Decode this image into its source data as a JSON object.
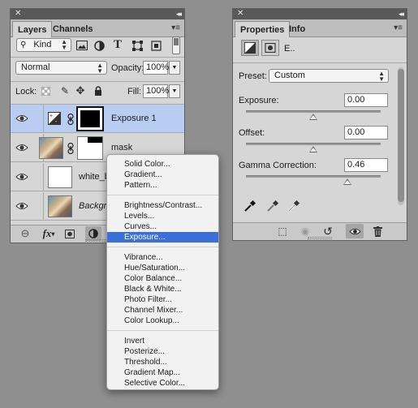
{
  "layers_panel": {
    "tabs": [
      "Layers",
      "Channels"
    ],
    "filter": {
      "value": "Kind"
    },
    "blend_mode": "Normal",
    "opacity_label": "Opacity:",
    "opacity": "100%",
    "lock_label": "Lock:",
    "fill_label": "Fill:",
    "fill": "100%",
    "layers": [
      {
        "name": "Exposure 1",
        "selected": true,
        "italic": false
      },
      {
        "name": "mask",
        "selected": false,
        "italic": false
      },
      {
        "name": "white_bg",
        "selected": false,
        "italic": false
      },
      {
        "name": "Background",
        "selected": false,
        "italic": true
      }
    ]
  },
  "properties_panel": {
    "tabs": [
      "Properties",
      "Info"
    ],
    "header_label": "E..",
    "preset_label": "Preset:",
    "preset_value": "Custom",
    "exposure_label": "Exposure:",
    "exposure_value": "0.00",
    "offset_label": "Offset:",
    "offset_value": "0.00",
    "gamma_label": "Gamma Correction:",
    "gamma_value": "0.46",
    "sliders": {
      "exposure": 0.5,
      "offset": 0.5,
      "gamma": 0.75
    }
  },
  "adjustment_menu": {
    "groups": [
      [
        "Solid Color...",
        "Gradient...",
        "Pattern..."
      ],
      [
        "Brightness/Contrast...",
        "Levels...",
        "Curves...",
        "Exposure..."
      ],
      [
        "Vibrance...",
        "Hue/Saturation...",
        "Color Balance...",
        "Black & White...",
        "Photo Filter...",
        "Channel Mixer...",
        "Color Lookup..."
      ],
      [
        "Invert",
        "Posterize...",
        "Threshold...",
        "Gradient Map...",
        "Selective Color..."
      ]
    ],
    "highlighted": "Exposure..."
  },
  "colors": {
    "selection": "#b9cdf3",
    "menu_highlight": "#3a6fd8"
  }
}
